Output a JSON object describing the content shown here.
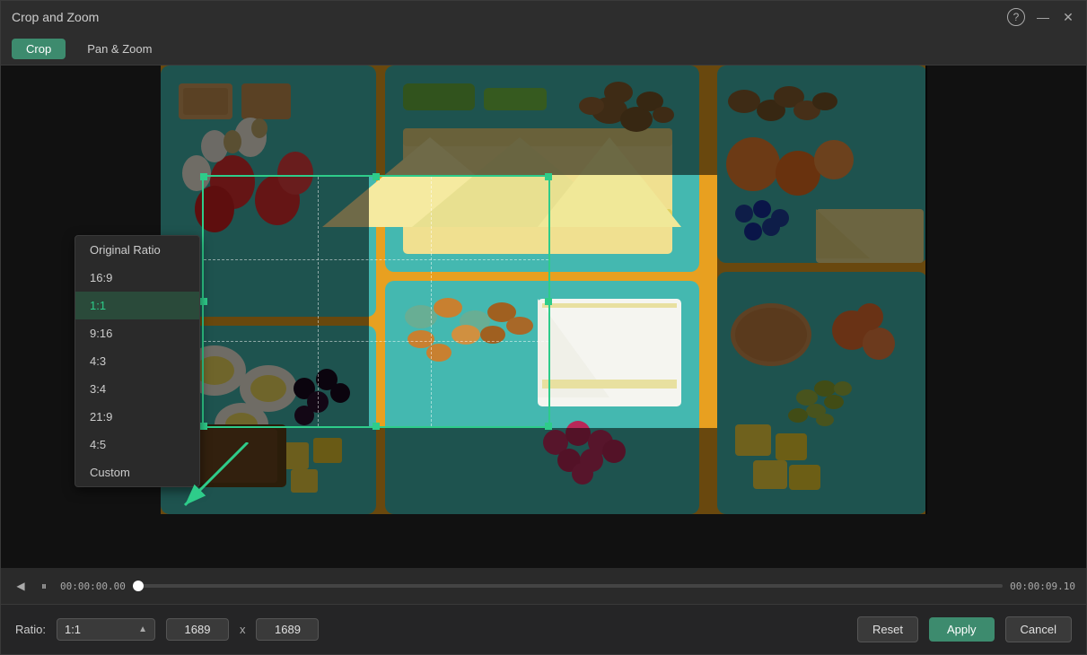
{
  "window": {
    "title": "Crop and Zoom"
  },
  "tabs": [
    {
      "id": "crop",
      "label": "Crop",
      "active": true
    },
    {
      "id": "pan-zoom",
      "label": "Pan & Zoom",
      "active": false
    }
  ],
  "toolbar": {
    "help_icon": "?",
    "minimize_icon": "—",
    "close_icon": "✕"
  },
  "timeline": {
    "time_start": "00:00:00.00",
    "time_end": "00:00:09.10"
  },
  "bottom_bar": {
    "ratio_label": "Ratio:",
    "ratio_value": "1:1",
    "width_value": "1689",
    "height_value": "1689",
    "x_separator": "x",
    "reset_label": "Reset",
    "apply_label": "Apply",
    "cancel_label": "Cancel"
  },
  "dropdown": {
    "items": [
      {
        "label": "Original Ratio",
        "active": false
      },
      {
        "label": "16:9",
        "active": false
      },
      {
        "label": "1:1",
        "active": true
      },
      {
        "label": "9:16",
        "active": false
      },
      {
        "label": "4:3",
        "active": false
      },
      {
        "label": "3:4",
        "active": false
      },
      {
        "label": "21:9",
        "active": false
      },
      {
        "label": "4:5",
        "active": false
      },
      {
        "label": "Custom",
        "active": false
      }
    ]
  }
}
